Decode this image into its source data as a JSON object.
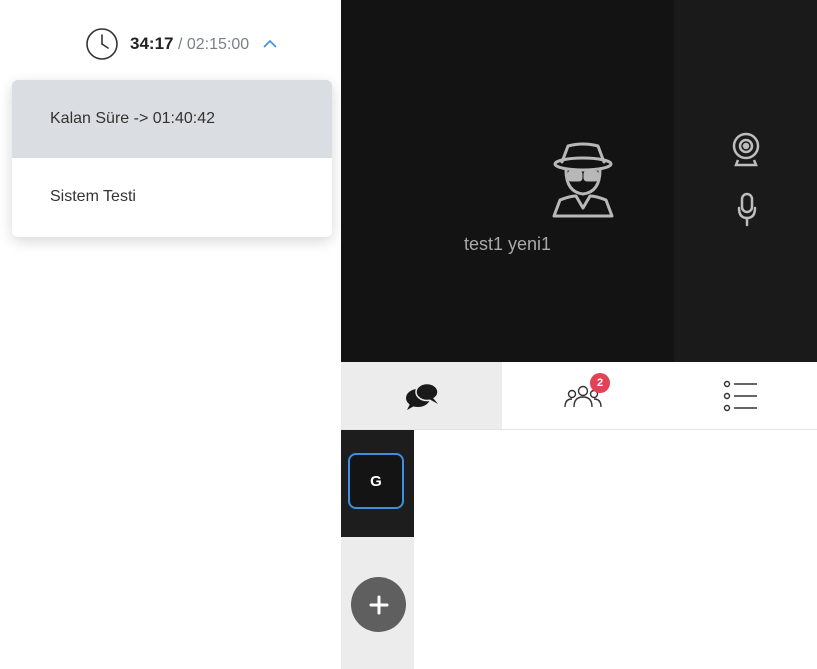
{
  "timer": {
    "elapsed": "34:17",
    "separator_total": "/ 02:15:00",
    "icon": "clock-icon",
    "toggle_icon": "chevron-up-icon"
  },
  "dropdown": {
    "items": [
      {
        "label": "Kalan Süre -> 01:40:42"
      },
      {
        "label": "Sistem Testi"
      }
    ]
  },
  "video": {
    "participant_name": "test1 yeni1",
    "avatar_icon": "spy-icon",
    "side_icons": [
      "webcam-icon",
      "microphone-icon"
    ]
  },
  "tabs": {
    "chat_icon": "chat-bubbles-icon",
    "participants_icon": "participants-icon",
    "participants_badge": "2",
    "list_icon": "list-icon"
  },
  "rail": {
    "group_label": "G",
    "add_icon": "plus-icon"
  },
  "colors": {
    "accent_blue": "#3d8fe0",
    "badge_red": "#e14356",
    "video_bg": "#131313"
  }
}
